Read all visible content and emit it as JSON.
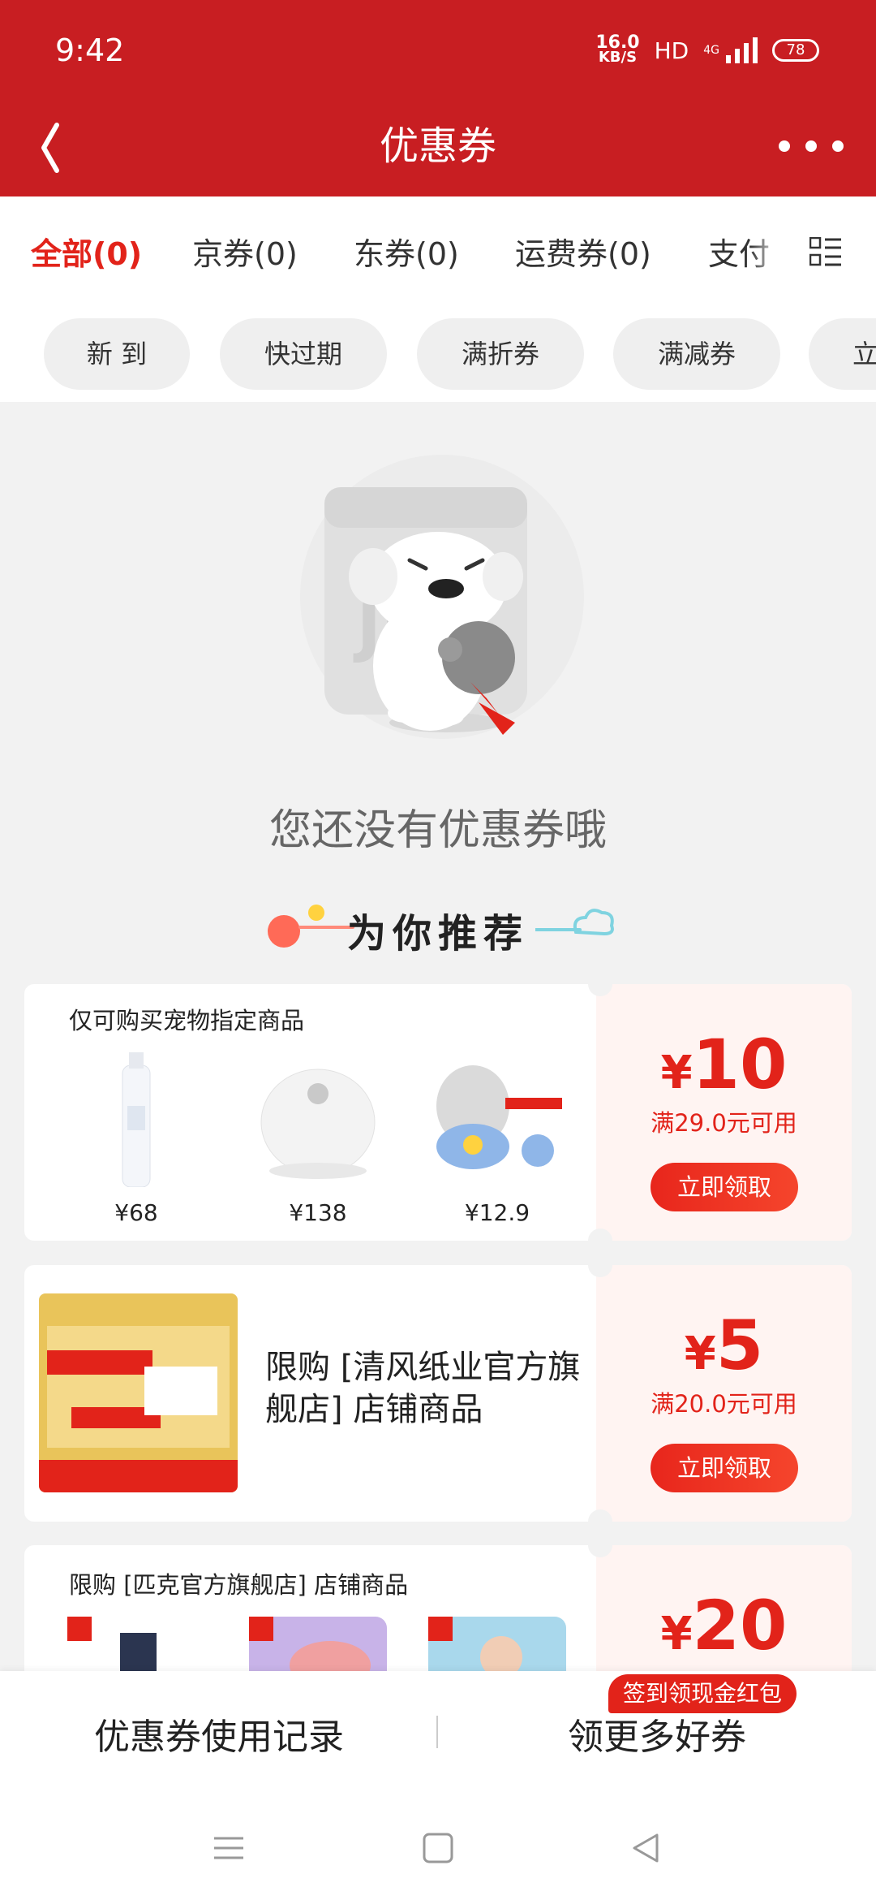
{
  "status_bar": {
    "time": "9:42",
    "net_speed_value": "16.0",
    "net_speed_unit": "KB/S",
    "hd": "HD",
    "network": "4G",
    "battery": "78"
  },
  "header": {
    "title": "优惠券",
    "back_icon": "chevron-left-icon",
    "more_icon": "more-dots-icon"
  },
  "tabs": [
    {
      "label": "全部(0)",
      "active": true
    },
    {
      "label": "京券(0)",
      "active": false
    },
    {
      "label": "东券(0)",
      "active": false
    },
    {
      "label": "运费券(0)",
      "active": false
    },
    {
      "label": "支付",
      "active": false
    }
  ],
  "filters": [
    "新 到",
    "快过期",
    "满折券",
    "满减券",
    "立"
  ],
  "empty_state": {
    "message": "您还没有优惠券哦"
  },
  "recommend": {
    "title": "为你推荐"
  },
  "coupons": [
    {
      "heading": "仅可购买宠物指定商品",
      "products": [
        {
          "price": "¥68"
        },
        {
          "price": "¥138"
        },
        {
          "price": "¥12.9"
        }
      ],
      "currency": "¥",
      "amount": "10",
      "condition": "满29.0元可用",
      "button": "立即领取"
    },
    {
      "shop_text": "限购 [清风纸业官方旗舰店] 店铺商品",
      "currency": "¥",
      "amount": "5",
      "condition": "满20.0元可用",
      "button": "立即领取"
    },
    {
      "heading": "限购 [匹克官方旗舰店] 店铺商品",
      "currency": "¥",
      "amount": "20"
    }
  ],
  "bottom_bar": {
    "left": "优惠券使用记录",
    "right": "领更多好券",
    "badge": "签到领现金红包"
  },
  "colors": {
    "brand_red": "#c81e22",
    "accent_red": "#e2231a",
    "page_bg": "#f2f2f2"
  }
}
